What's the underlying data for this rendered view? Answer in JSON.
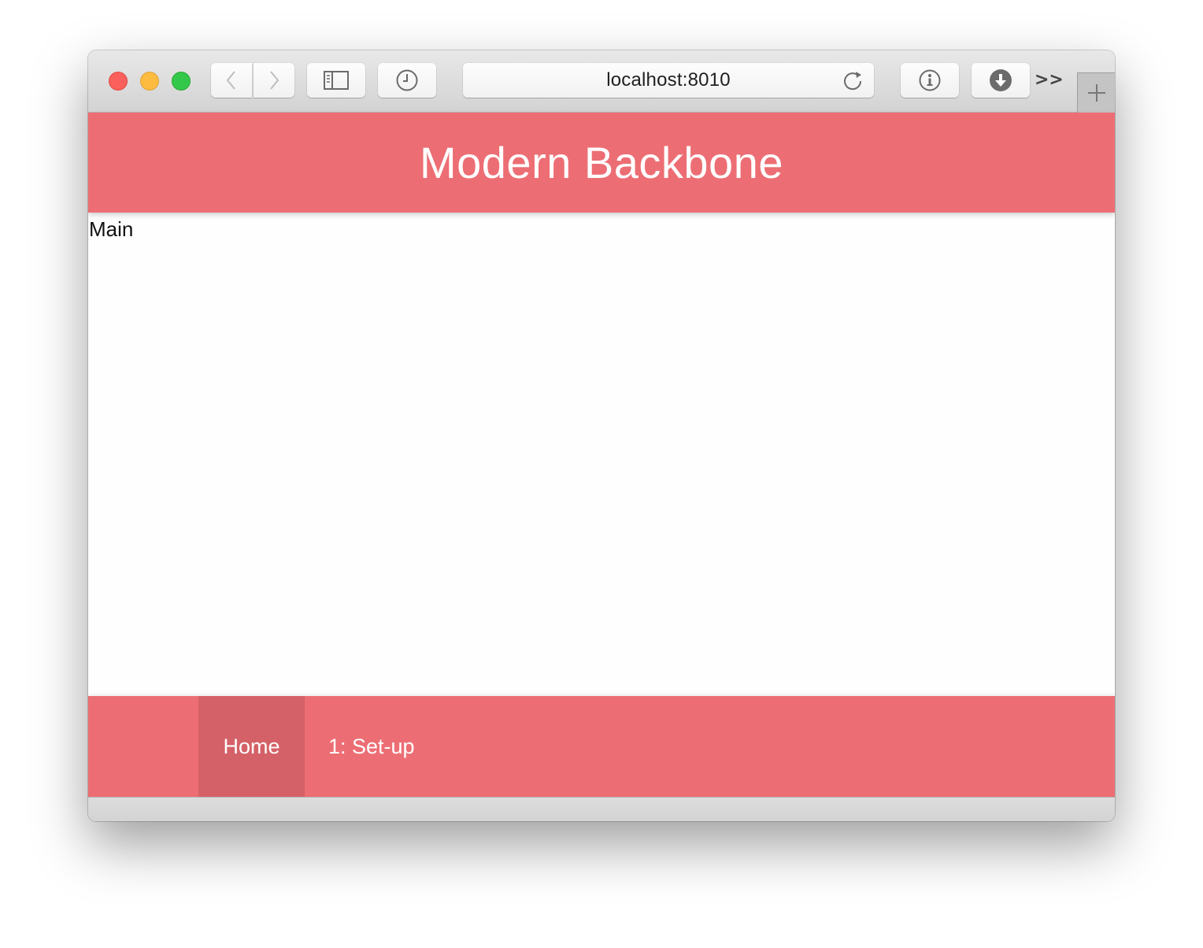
{
  "browser": {
    "address": "localhost:8010",
    "icons": {
      "back": "chevron-left-icon",
      "forward": "chevron-right-icon",
      "sidebar": "sidebar-icon",
      "history": "clock-icon",
      "reload": "reload-icon",
      "info": "info-icon",
      "download": "download-icon",
      "overflow": "double-chevron-right-icon",
      "new_tab": "plus-icon"
    },
    "overflow_label": ">>"
  },
  "app": {
    "title": "Modern Backbone",
    "main_label": "Main",
    "nav": [
      {
        "label": "Home",
        "active": true
      },
      {
        "label": "1: Set-up",
        "active": false
      }
    ]
  },
  "colors": {
    "brand": "#ec6e74",
    "brand_active": "#d56168",
    "text_on_brand": "#ffffff"
  }
}
